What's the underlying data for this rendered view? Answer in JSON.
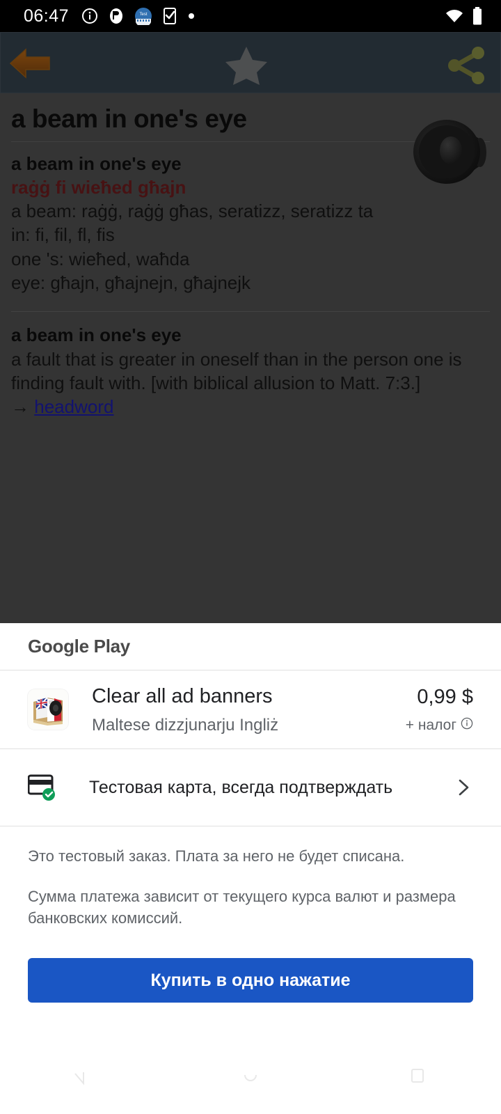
{
  "status_bar": {
    "time": "06:47",
    "icons": [
      "info-icon",
      "notification-app-icon",
      "test-badge-icon",
      "phone-check-icon",
      "dot-icon"
    ],
    "right_icons": [
      "wifi-icon",
      "battery-icon"
    ]
  },
  "dictionary": {
    "toolbar": {
      "back_icon": "back-arrow-icon",
      "star_icon": "star-icon",
      "share_icon": "share-icon",
      "background_color": "#3c4a57"
    },
    "headword": "a beam in one's eye",
    "speaker_icon": "speaker-icon",
    "translation_block": {
      "source": "a beam in one's eye",
      "target": "raġġ fi wieħed għajn",
      "target_color": "#7b1f22",
      "lines": [
        "a beam: raġġ, raġġ għas, seratizz, seratizz ta",
        "in: fi, fil, fl, fis",
        "one 's: wieħed, waħda",
        "eye: għajn, għajnejn, għajnejk"
      ]
    },
    "definition_block": {
      "headword": "a beam in one's eye",
      "definition": "a fault that is greater in oneself than in the person one is finding fault with. [with biblical allusion to Matt. 7:3.]",
      "link_arrow": "→",
      "link_text": "headword",
      "link_color": "#2020c0"
    }
  },
  "purchase_sheet": {
    "brand": "Google Play",
    "item": {
      "icon": "dictionary-book-app-icon",
      "title": "Clear all ad banners",
      "subtitle": "Maltese dizzjunarju Ingliż",
      "price": "0,99 $",
      "tax_note": "+ налог",
      "tax_info_icon": "info-circle-icon"
    },
    "payment": {
      "icon": "credit-card-verified-icon",
      "label": "Тестовая карта, всегда подтверждать",
      "chevron_icon": "chevron-right-icon"
    },
    "notes": [
      "Это тестовый заказ. Плата за него не будет списана.",
      "Сумма платежа зависит от текущего курса валют и размера банковских комиссий."
    ],
    "buy_button": {
      "label": "Купить в одно нажатие",
      "color": "#1a56c4"
    }
  },
  "nav_bar": {
    "back_icon": "nav-back-icon",
    "home_icon": "nav-home-icon",
    "recents_icon": "nav-recents-icon"
  }
}
